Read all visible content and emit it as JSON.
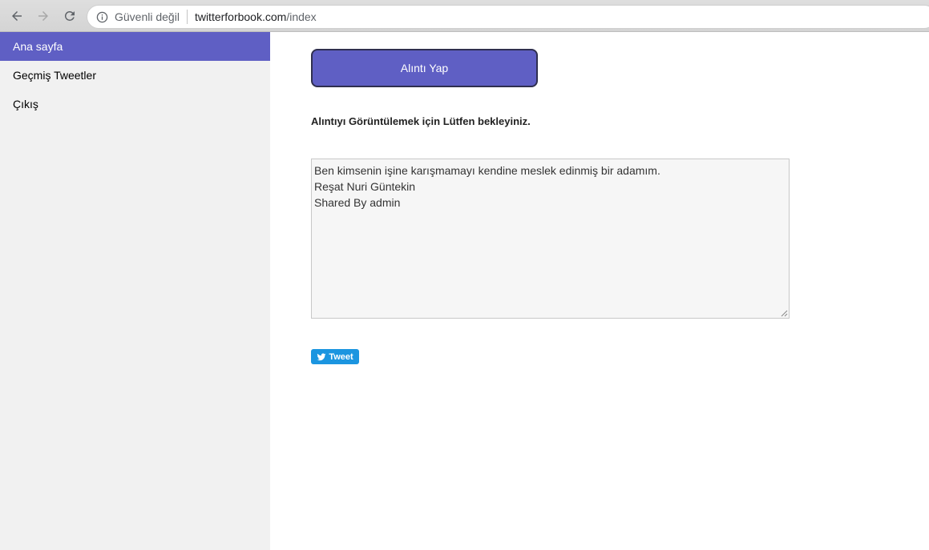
{
  "browser": {
    "security_label": "Güvenli değil",
    "url_host": "twitterforbook.com",
    "url_path": "/index",
    "icons": [
      "back-icon",
      "forward-icon",
      "reload-icon",
      "info-icon"
    ]
  },
  "sidebar": {
    "items": [
      {
        "label": "Ana sayfa",
        "active": true
      },
      {
        "label": "Geçmiş Tweetler",
        "active": false
      },
      {
        "label": "Çıkış",
        "active": false
      }
    ]
  },
  "main": {
    "quote_button_label": "Alıntı Yap",
    "wait_message": "Alıntıyı Görüntülemek için Lütfen bekleyiniz.",
    "quote_lines": [
      "Ben kimsenin işine karışmamayı kendine meslek edinmiş bir adamım.",
      "Reşat Nuri Güntekin",
      "Shared By admin"
    ],
    "tweet_button_label": "Tweet"
  },
  "colors": {
    "accent": "#5f5fc4",
    "sidebar_bg": "#f1f1f1",
    "twitter_blue": "#1b95e0"
  }
}
